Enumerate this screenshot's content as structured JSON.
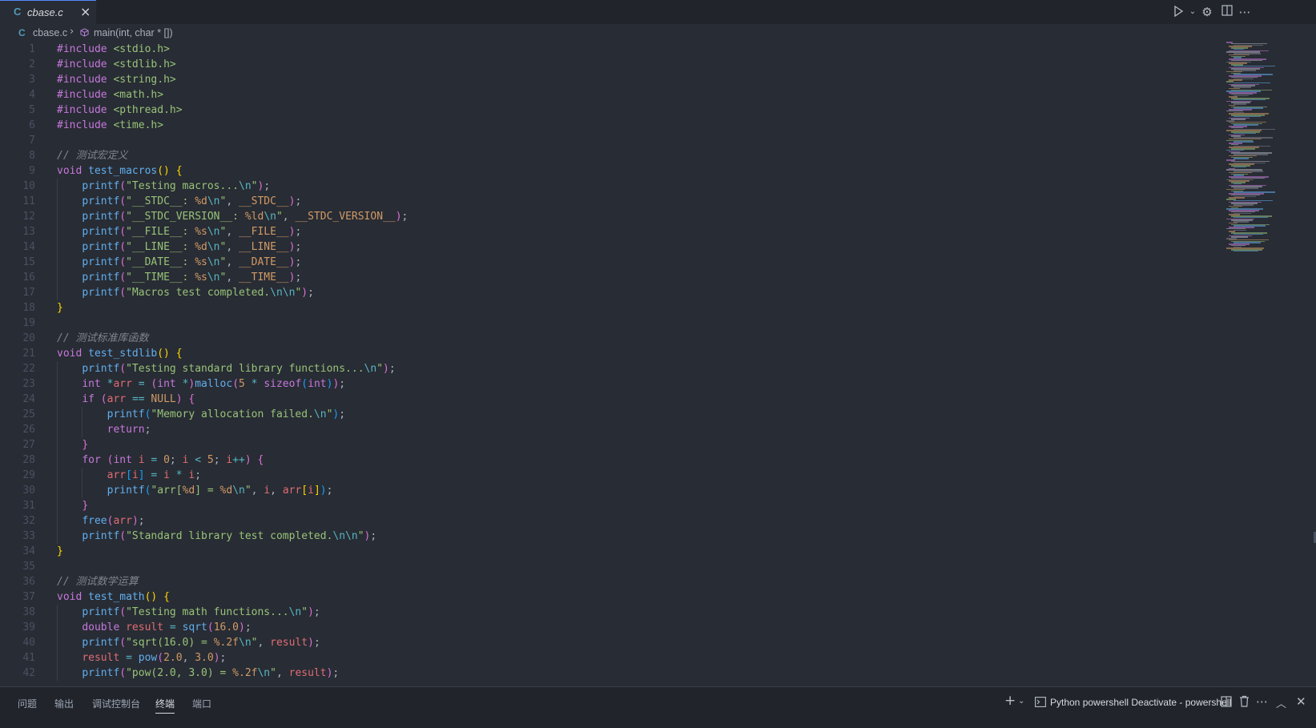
{
  "tab": {
    "label": "cbase.c",
    "icon": "c-language-icon"
  },
  "toolbar": {
    "icons": [
      "run-icon",
      "chevron-down-icon",
      "gear-icon",
      "split-editor-icon",
      "more-icon"
    ]
  },
  "breadcrumb": {
    "file": "cbase.c",
    "symbol": "main(int, char * [])"
  },
  "code_lines": [
    {
      "n": "1",
      "segs": [
        [
          "#include",
          "k"
        ],
        [
          " ",
          "p"
        ],
        [
          "<stdio.h>",
          "s"
        ]
      ]
    },
    {
      "n": "2",
      "segs": [
        [
          "#include",
          "k"
        ],
        [
          " ",
          "p"
        ],
        [
          "<stdlib.h>",
          "s"
        ]
      ]
    },
    {
      "n": "3",
      "segs": [
        [
          "#include",
          "k"
        ],
        [
          " ",
          "p"
        ],
        [
          "<string.h>",
          "s"
        ]
      ]
    },
    {
      "n": "4",
      "segs": [
        [
          "#include",
          "k"
        ],
        [
          " ",
          "p"
        ],
        [
          "<math.h>",
          "s"
        ]
      ]
    },
    {
      "n": "5",
      "segs": [
        [
          "#include",
          "k"
        ],
        [
          " ",
          "p"
        ],
        [
          "<pthread.h>",
          "s"
        ]
      ]
    },
    {
      "n": "6",
      "segs": [
        [
          "#include",
          "k"
        ],
        [
          " ",
          "p"
        ],
        [
          "<time.h>",
          "s"
        ]
      ]
    },
    {
      "n": "7",
      "segs": []
    },
    {
      "n": "8",
      "segs": [
        [
          "// 测试宏定义",
          "c"
        ]
      ]
    },
    {
      "n": "9",
      "segs": [
        [
          "void",
          "k"
        ],
        [
          " ",
          "p"
        ],
        [
          "test_macros",
          "f"
        ],
        [
          "()",
          "br1"
        ],
        [
          " ",
          "p"
        ],
        [
          "{",
          "br1"
        ]
      ]
    },
    {
      "n": "10",
      "segs": [
        [
          "    ",
          "p"
        ],
        [
          "printf",
          "f"
        ],
        [
          "(",
          "br2"
        ],
        [
          "\"Testing macros...",
          "s"
        ],
        [
          "\\n",
          "e"
        ],
        [
          "\"",
          "s"
        ],
        [
          ")",
          "br2"
        ],
        [
          ";",
          "p"
        ]
      ]
    },
    {
      "n": "11",
      "segs": [
        [
          "    ",
          "p"
        ],
        [
          "printf",
          "f"
        ],
        [
          "(",
          "br2"
        ],
        [
          "\"__STDC__: ",
          "s"
        ],
        [
          "%d",
          "n"
        ],
        [
          "\\n",
          "e"
        ],
        [
          "\"",
          "s"
        ],
        [
          ", ",
          "p"
        ],
        [
          "__STDC__",
          "n"
        ],
        [
          ")",
          "br2"
        ],
        [
          ";",
          "p"
        ]
      ]
    },
    {
      "n": "12",
      "segs": [
        [
          "    ",
          "p"
        ],
        [
          "printf",
          "f"
        ],
        [
          "(",
          "br2"
        ],
        [
          "\"__STDC_VERSION__: ",
          "s"
        ],
        [
          "%ld",
          "n"
        ],
        [
          "\\n",
          "e"
        ],
        [
          "\"",
          "s"
        ],
        [
          ", ",
          "p"
        ],
        [
          "__STDC_VERSION__",
          "n"
        ],
        [
          ")",
          "br2"
        ],
        [
          ";",
          "p"
        ]
      ]
    },
    {
      "n": "13",
      "segs": [
        [
          "    ",
          "p"
        ],
        [
          "printf",
          "f"
        ],
        [
          "(",
          "br2"
        ],
        [
          "\"__FILE__: ",
          "s"
        ],
        [
          "%s",
          "n"
        ],
        [
          "\\n",
          "e"
        ],
        [
          "\"",
          "s"
        ],
        [
          ", ",
          "p"
        ],
        [
          "__FILE__",
          "n"
        ],
        [
          ")",
          "br2"
        ],
        [
          ";",
          "p"
        ]
      ]
    },
    {
      "n": "14",
      "segs": [
        [
          "    ",
          "p"
        ],
        [
          "printf",
          "f"
        ],
        [
          "(",
          "br2"
        ],
        [
          "\"__LINE__: ",
          "s"
        ],
        [
          "%d",
          "n"
        ],
        [
          "\\n",
          "e"
        ],
        [
          "\"",
          "s"
        ],
        [
          ", ",
          "p"
        ],
        [
          "__LINE__",
          "n"
        ],
        [
          ")",
          "br2"
        ],
        [
          ";",
          "p"
        ]
      ]
    },
    {
      "n": "15",
      "segs": [
        [
          "    ",
          "p"
        ],
        [
          "printf",
          "f"
        ],
        [
          "(",
          "br2"
        ],
        [
          "\"__DATE__: ",
          "s"
        ],
        [
          "%s",
          "n"
        ],
        [
          "\\n",
          "e"
        ],
        [
          "\"",
          "s"
        ],
        [
          ", ",
          "p"
        ],
        [
          "__DATE__",
          "n"
        ],
        [
          ")",
          "br2"
        ],
        [
          ";",
          "p"
        ]
      ]
    },
    {
      "n": "16",
      "segs": [
        [
          "    ",
          "p"
        ],
        [
          "printf",
          "f"
        ],
        [
          "(",
          "br2"
        ],
        [
          "\"__TIME__: ",
          "s"
        ],
        [
          "%s",
          "n"
        ],
        [
          "\\n",
          "e"
        ],
        [
          "\"",
          "s"
        ],
        [
          ", ",
          "p"
        ],
        [
          "__TIME__",
          "n"
        ],
        [
          ")",
          "br2"
        ],
        [
          ";",
          "p"
        ]
      ]
    },
    {
      "n": "17",
      "segs": [
        [
          "    ",
          "p"
        ],
        [
          "printf",
          "f"
        ],
        [
          "(",
          "br2"
        ],
        [
          "\"Macros test completed.",
          "s"
        ],
        [
          "\\n\\n",
          "e"
        ],
        [
          "\"",
          "s"
        ],
        [
          ")",
          "br2"
        ],
        [
          ";",
          "p"
        ]
      ]
    },
    {
      "n": "18",
      "segs": [
        [
          "}",
          "br1"
        ]
      ]
    },
    {
      "n": "19",
      "segs": []
    },
    {
      "n": "20",
      "segs": [
        [
          "// 测试标准库函数",
          "c"
        ]
      ]
    },
    {
      "n": "21",
      "segs": [
        [
          "void",
          "k"
        ],
        [
          " ",
          "p"
        ],
        [
          "test_stdlib",
          "f"
        ],
        [
          "()",
          "br1"
        ],
        [
          " ",
          "p"
        ],
        [
          "{",
          "br1"
        ]
      ]
    },
    {
      "n": "22",
      "segs": [
        [
          "    ",
          "p"
        ],
        [
          "printf",
          "f"
        ],
        [
          "(",
          "br2"
        ],
        [
          "\"Testing standard library functions...",
          "s"
        ],
        [
          "\\n",
          "e"
        ],
        [
          "\"",
          "s"
        ],
        [
          ")",
          "br2"
        ],
        [
          ";",
          "p"
        ]
      ]
    },
    {
      "n": "23",
      "segs": [
        [
          "    ",
          "p"
        ],
        [
          "int",
          "k"
        ],
        [
          " ",
          "p"
        ],
        [
          "*",
          "e"
        ],
        [
          "arr",
          "v"
        ],
        [
          " ",
          "p"
        ],
        [
          "=",
          "e"
        ],
        [
          " ",
          "p"
        ],
        [
          "(",
          "br2"
        ],
        [
          "int",
          "k"
        ],
        [
          " ",
          "p"
        ],
        [
          "*",
          "e"
        ],
        [
          ")",
          "br2"
        ],
        [
          "malloc",
          "f"
        ],
        [
          "(",
          "br2"
        ],
        [
          "5",
          "n"
        ],
        [
          " ",
          "p"
        ],
        [
          "*",
          "e"
        ],
        [
          " ",
          "p"
        ],
        [
          "sizeof",
          "k"
        ],
        [
          "(",
          "br3"
        ],
        [
          "int",
          "k"
        ],
        [
          ")",
          "br3"
        ],
        [
          ")",
          "br2"
        ],
        [
          ";",
          "p"
        ]
      ]
    },
    {
      "n": "24",
      "segs": [
        [
          "    ",
          "p"
        ],
        [
          "if",
          "k"
        ],
        [
          " ",
          "p"
        ],
        [
          "(",
          "br2"
        ],
        [
          "arr",
          "v"
        ],
        [
          " ",
          "p"
        ],
        [
          "==",
          "e"
        ],
        [
          " ",
          "p"
        ],
        [
          "NULL",
          "n"
        ],
        [
          ")",
          "br2"
        ],
        [
          " ",
          "p"
        ],
        [
          "{",
          "br2"
        ]
      ]
    },
    {
      "n": "25",
      "segs": [
        [
          "        ",
          "p"
        ],
        [
          "printf",
          "f"
        ],
        [
          "(",
          "br3"
        ],
        [
          "\"Memory allocation failed.",
          "s"
        ],
        [
          "\\n",
          "e"
        ],
        [
          "\"",
          "s"
        ],
        [
          ")",
          "br3"
        ],
        [
          ";",
          "p"
        ]
      ]
    },
    {
      "n": "26",
      "segs": [
        [
          "        ",
          "p"
        ],
        [
          "return",
          "k"
        ],
        [
          ";",
          "p"
        ]
      ]
    },
    {
      "n": "27",
      "segs": [
        [
          "    ",
          "p"
        ],
        [
          "}",
          "br2"
        ]
      ]
    },
    {
      "n": "28",
      "segs": [
        [
          "    ",
          "p"
        ],
        [
          "for",
          "k"
        ],
        [
          " ",
          "p"
        ],
        [
          "(",
          "br2"
        ],
        [
          "int",
          "k"
        ],
        [
          " ",
          "p"
        ],
        [
          "i",
          "v"
        ],
        [
          " ",
          "p"
        ],
        [
          "=",
          "e"
        ],
        [
          " ",
          "p"
        ],
        [
          "0",
          "n"
        ],
        [
          "; ",
          "p"
        ],
        [
          "i",
          "v"
        ],
        [
          " ",
          "p"
        ],
        [
          "<",
          "e"
        ],
        [
          " ",
          "p"
        ],
        [
          "5",
          "n"
        ],
        [
          "; ",
          "p"
        ],
        [
          "i",
          "v"
        ],
        [
          "++",
          "e"
        ],
        [
          ")",
          "br2"
        ],
        [
          " ",
          "p"
        ],
        [
          "{",
          "br2"
        ]
      ]
    },
    {
      "n": "29",
      "segs": [
        [
          "        ",
          "p"
        ],
        [
          "arr",
          "v"
        ],
        [
          "[",
          "br3"
        ],
        [
          "i",
          "v"
        ],
        [
          "]",
          "br3"
        ],
        [
          " ",
          "p"
        ],
        [
          "=",
          "e"
        ],
        [
          " ",
          "p"
        ],
        [
          "i",
          "v"
        ],
        [
          " ",
          "p"
        ],
        [
          "*",
          "e"
        ],
        [
          " ",
          "p"
        ],
        [
          "i",
          "v"
        ],
        [
          ";",
          "p"
        ]
      ]
    },
    {
      "n": "30",
      "segs": [
        [
          "        ",
          "p"
        ],
        [
          "printf",
          "f"
        ],
        [
          "(",
          "br3"
        ],
        [
          "\"arr[",
          "s"
        ],
        [
          "%d",
          "n"
        ],
        [
          "] = ",
          "s"
        ],
        [
          "%d",
          "n"
        ],
        [
          "\\n",
          "e"
        ],
        [
          "\"",
          "s"
        ],
        [
          ", ",
          "p"
        ],
        [
          "i",
          "v"
        ],
        [
          ", ",
          "p"
        ],
        [
          "arr",
          "v"
        ],
        [
          "[",
          "br1"
        ],
        [
          "i",
          "v"
        ],
        [
          "]",
          "br1"
        ],
        [
          ")",
          "br3"
        ],
        [
          ";",
          "p"
        ]
      ]
    },
    {
      "n": "31",
      "segs": [
        [
          "    ",
          "p"
        ],
        [
          "}",
          "br2"
        ]
      ]
    },
    {
      "n": "32",
      "segs": [
        [
          "    ",
          "p"
        ],
        [
          "free",
          "f"
        ],
        [
          "(",
          "br2"
        ],
        [
          "arr",
          "v"
        ],
        [
          ")",
          "br2"
        ],
        [
          ";",
          "p"
        ]
      ]
    },
    {
      "n": "33",
      "segs": [
        [
          "    ",
          "p"
        ],
        [
          "printf",
          "f"
        ],
        [
          "(",
          "br2"
        ],
        [
          "\"Standard library test completed.",
          "s"
        ],
        [
          "\\n\\n",
          "e"
        ],
        [
          "\"",
          "s"
        ],
        [
          ")",
          "br2"
        ],
        [
          ";",
          "p"
        ]
      ]
    },
    {
      "n": "34",
      "segs": [
        [
          "}",
          "br1"
        ]
      ]
    },
    {
      "n": "35",
      "segs": []
    },
    {
      "n": "36",
      "segs": [
        [
          "// 测试数学运算",
          "c"
        ]
      ]
    },
    {
      "n": "37",
      "segs": [
        [
          "void",
          "k"
        ],
        [
          " ",
          "p"
        ],
        [
          "test_math",
          "f"
        ],
        [
          "()",
          "br1"
        ],
        [
          " ",
          "p"
        ],
        [
          "{",
          "br1"
        ]
      ]
    },
    {
      "n": "38",
      "segs": [
        [
          "    ",
          "p"
        ],
        [
          "printf",
          "f"
        ],
        [
          "(",
          "br2"
        ],
        [
          "\"Testing math functions...",
          "s"
        ],
        [
          "\\n",
          "e"
        ],
        [
          "\"",
          "s"
        ],
        [
          ")",
          "br2"
        ],
        [
          ";",
          "p"
        ]
      ]
    },
    {
      "n": "39",
      "segs": [
        [
          "    ",
          "p"
        ],
        [
          "double",
          "k"
        ],
        [
          " ",
          "p"
        ],
        [
          "result",
          "v"
        ],
        [
          " ",
          "p"
        ],
        [
          "=",
          "e"
        ],
        [
          " ",
          "p"
        ],
        [
          "sqrt",
          "f"
        ],
        [
          "(",
          "br2"
        ],
        [
          "16.0",
          "n"
        ],
        [
          ")",
          "br2"
        ],
        [
          ";",
          "p"
        ]
      ]
    },
    {
      "n": "40",
      "segs": [
        [
          "    ",
          "p"
        ],
        [
          "printf",
          "f"
        ],
        [
          "(",
          "br2"
        ],
        [
          "\"sqrt(16.0) = ",
          "s"
        ],
        [
          "%.2f",
          "n"
        ],
        [
          "\\n",
          "e"
        ],
        [
          "\"",
          "s"
        ],
        [
          ", ",
          "p"
        ],
        [
          "result",
          "v"
        ],
        [
          ")",
          "br2"
        ],
        [
          ";",
          "p"
        ]
      ]
    },
    {
      "n": "41",
      "segs": [
        [
          "    ",
          "p"
        ],
        [
          "result",
          "v"
        ],
        [
          " ",
          "p"
        ],
        [
          "=",
          "e"
        ],
        [
          " ",
          "p"
        ],
        [
          "pow",
          "f"
        ],
        [
          "(",
          "br2"
        ],
        [
          "2.0",
          "n"
        ],
        [
          ", ",
          "p"
        ],
        [
          "3.0",
          "n"
        ],
        [
          ")",
          "br2"
        ],
        [
          ";",
          "p"
        ]
      ]
    },
    {
      "n": "42",
      "segs": [
        [
          "    ",
          "p"
        ],
        [
          "printf",
          "f"
        ],
        [
          "(",
          "br2"
        ],
        [
          "\"pow(2.0, 3.0) = ",
          "s"
        ],
        [
          "%.2f",
          "n"
        ],
        [
          "\\n",
          "e"
        ],
        [
          "\"",
          "s"
        ],
        [
          ", ",
          "p"
        ],
        [
          "result",
          "v"
        ],
        [
          ")",
          "br2"
        ],
        [
          ";",
          "p"
        ]
      ]
    }
  ],
  "panel": {
    "tabs": [
      "问题",
      "输出",
      "调试控制台",
      "终端",
      "端口"
    ],
    "active_tab": "终端",
    "terminal_name": "Python powershell Deactivate - powershell",
    "icons": [
      "add-terminal-icon",
      "chevron-down-icon",
      "terminal-icon",
      "split-terminal-icon",
      "trash-icon",
      "more-icon",
      "maximize-panel-icon",
      "close-panel-icon"
    ]
  },
  "colors": {
    "editor_bg": "#282c34",
    "tabbar_bg": "#21252b",
    "keyword": "#c678dd",
    "function": "#61afef",
    "string": "#98c379",
    "number": "#d19a66",
    "comment": "#7f848e",
    "variable": "#e06c75",
    "operator": "#56b6c2"
  }
}
